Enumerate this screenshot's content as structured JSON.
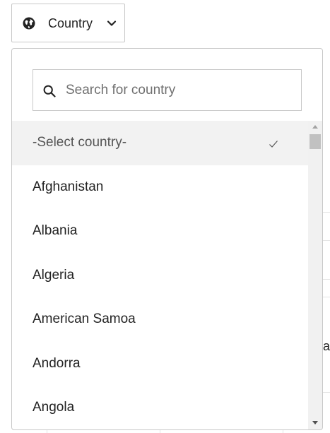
{
  "trigger": {
    "label": "Country",
    "icon": "globe-icon",
    "chevron": "chevron-down-icon"
  },
  "search": {
    "placeholder": "Search for country",
    "value": "",
    "icon": "search-icon"
  },
  "list": {
    "items": [
      {
        "label": "-Select country-",
        "selected": true
      },
      {
        "label": "Afghanistan",
        "selected": false
      },
      {
        "label": "Albania",
        "selected": false
      },
      {
        "label": "Algeria",
        "selected": false
      },
      {
        "label": "American Samoa",
        "selected": false
      },
      {
        "label": "Andorra",
        "selected": false
      },
      {
        "label": "Angola",
        "selected": false
      }
    ]
  },
  "background": {
    "fragment_text": "ar"
  },
  "colors": {
    "selected_row": "#f2f2f2",
    "border": "#c8c8c8",
    "text": "#222222",
    "placeholder": "#707070"
  }
}
